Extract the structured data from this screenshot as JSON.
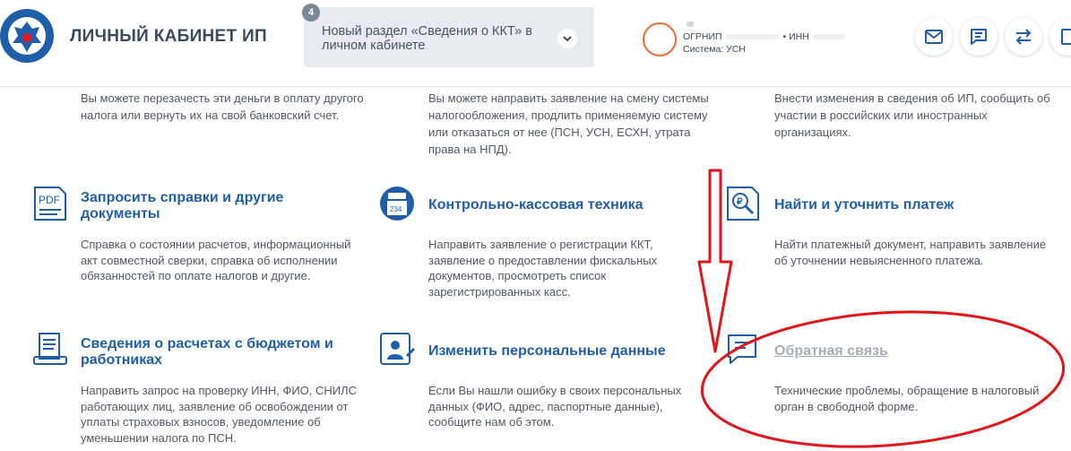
{
  "header": {
    "app_title": "ЛИЧНЫЙ КАБИНЕТ ИП",
    "notice": {
      "count": "4",
      "text": "Новый раздел «Сведения о ККТ» в личном кабинете"
    },
    "user": {
      "ogrnip_label": "ОГРНИП",
      "inn_label": "• ИНН",
      "tax_system": "Система: УСН"
    }
  },
  "top_descriptions": {
    "col1": "Вы можете перезачесть эти деньги в оплату другого налога или вернуть их на свой банковский счет.",
    "col2": "Вы можете направить заявление на смену системы налогообложения, продлить применяемую систему или отказаться от нее (ПСН, УСН, ЕСХН, утрата права на НПД).",
    "col3": "Внести изменения в сведения об ИП, сообщить об участии в российских или иностранных организациях."
  },
  "cards": {
    "certificates": {
      "title": "Запросить справки и другие документы",
      "desc": "Справка о состоянии расчетов, информационный акт совместной сверки, справка об исполнении обязанностей по оплате налогов и другие.",
      "icon_text": "PDF"
    },
    "kkt": {
      "title": "Контрольно-кассовая техника",
      "desc": "Направить заявление о регистрации ККТ, заявление о предоставлении фискальных документов, просмотреть список зарегистрированных касс.",
      "icon_text": "234"
    },
    "payment": {
      "title": "Найти и уточнить платеж",
      "desc": "Найти платежный документ, направить заявление об уточнении невыясненного платежа."
    },
    "budget": {
      "title": "Сведения о расчетах с бюджетом и работниках",
      "desc": "Направить запрос на проверку ИНН, ФИО, СНИЛС работающих лиц, заявление об освобождении от уплаты страховых взносов, уведомление об уменьшении налога по ПСН."
    },
    "personal": {
      "title": "Изменить персональные данные",
      "desc": "Если Вы нашли ошибку в своих персональных данных (ФИО, адрес, паспортные данные), сообщите нам об этом."
    },
    "feedback": {
      "title": "Обратная связь",
      "desc": "Технические проблемы, обращение в налоговый орган в свободной форме."
    }
  },
  "colors": {
    "accent": "#1f5ea8",
    "annotation": "#e3141b",
    "avatar_ring": "#f06a35"
  }
}
